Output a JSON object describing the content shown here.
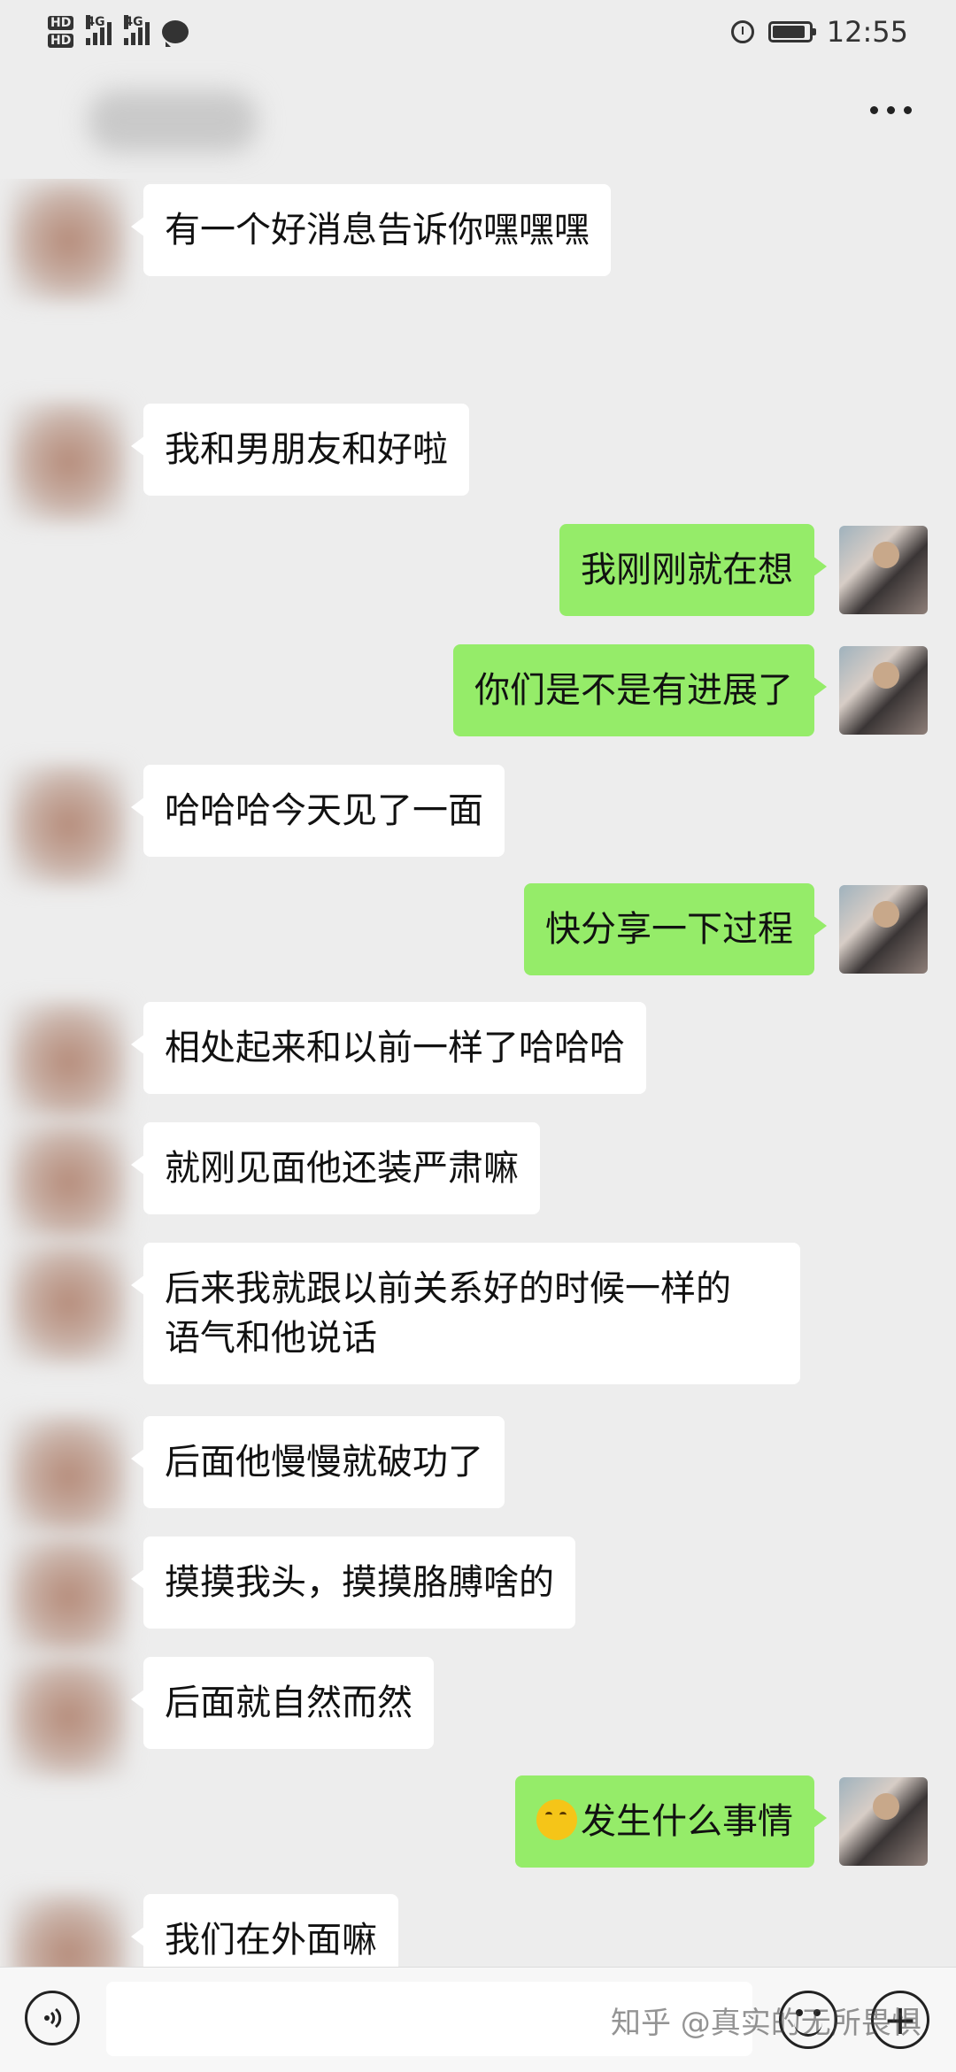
{
  "status_bar": {
    "hd1": "HD",
    "hd2": "HD",
    "net1": "4G",
    "net2": "4G",
    "time": "12:55",
    "battery_level": 0.9
  },
  "header": {
    "title_blurred": "",
    "more_icon": "more-dots-icon"
  },
  "messages": [
    {
      "side": "left",
      "text": "有一个好消息告诉你嘿嘿嘿"
    },
    {
      "side": "left",
      "text": "我和男朋友和好啦"
    },
    {
      "side": "right",
      "text": "我刚刚就在想"
    },
    {
      "side": "right",
      "text": "你们是不是有进展了"
    },
    {
      "side": "left",
      "text": "哈哈哈今天见了一面"
    },
    {
      "side": "right",
      "text": "快分享一下过程"
    },
    {
      "side": "left",
      "text": "相处起来和以前一样了哈哈哈"
    },
    {
      "side": "left",
      "text": "就刚见面他还装严肃嘛"
    },
    {
      "side": "left",
      "line1": "后来我就跟以前关系好的时候一样的",
      "line2": "语气和他说话"
    },
    {
      "side": "left",
      "text": "后面他慢慢就破功了"
    },
    {
      "side": "left",
      "text": "摸摸我头，摸摸胳膊啥的"
    },
    {
      "side": "left",
      "text": "后面就自然而然"
    },
    {
      "side": "right",
      "emoji": "thinking-face-emoji",
      "text": "发生什么事情"
    },
    {
      "side": "left",
      "text": "我们在外面嘛"
    }
  ],
  "input_bar": {
    "voice_icon": "voice-icon",
    "emoji_icon": "smiley-icon",
    "plus_icon": "plus-icon"
  },
  "watermark": "知乎 @真实的无所畏惧"
}
